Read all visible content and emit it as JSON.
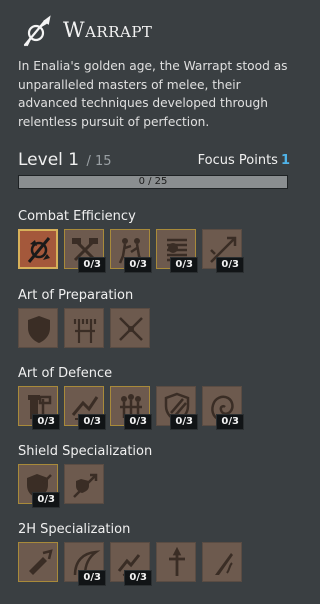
{
  "class": {
    "title": "Warrapt",
    "icon": "crossed-sword-emblem-icon",
    "description": "In Enalia's golden age, the Warrapt stood as unparalleled masters of melee, their advanced techniques developed through relentless pursuit of perfection."
  },
  "progress": {
    "level_label": "Level 1",
    "level_max": "/ 15",
    "focus_label": "Focus Points",
    "focus_value": "1",
    "xp_text": "0 / 25",
    "xp_fraction": 0
  },
  "sections": [
    {
      "title": "Combat Efficiency",
      "skills": [
        {
          "icon": "crossed-axe-emblem-icon",
          "rank": "",
          "state": "selected"
        },
        {
          "icon": "crossed-hammers-icon",
          "rank": "0/3",
          "state": "available"
        },
        {
          "icon": "fighting-warriors-icon",
          "rank": "0/3",
          "state": "available"
        },
        {
          "icon": "armored-figure-icon",
          "rank": "0/3",
          "state": "available"
        },
        {
          "icon": "spear-thrust-icon",
          "rank": "0/3",
          "state": "locked"
        }
      ]
    },
    {
      "title": "Art of Preparation",
      "skills": [
        {
          "icon": "shield-icon",
          "rank": "",
          "state": "locked"
        },
        {
          "icon": "trident-weapons-icon",
          "rank": "",
          "state": "locked"
        },
        {
          "icon": "crossed-weapons-icon",
          "rank": "",
          "state": "locked"
        }
      ]
    },
    {
      "title": "Art of Defence",
      "skills": [
        {
          "icon": "tower-hammer-icon",
          "rank": "0/3",
          "state": "available"
        },
        {
          "icon": "sword-slash-icon",
          "rank": "0/3",
          "state": "available"
        },
        {
          "icon": "group-defenders-icon",
          "rank": "0/3",
          "state": "available"
        },
        {
          "icon": "striped-shield-icon",
          "rank": "0/3",
          "state": "locked"
        },
        {
          "icon": "spiral-shell-icon",
          "rank": "0/3",
          "state": "locked"
        }
      ]
    },
    {
      "title": "Shield Specialization",
      "skills": [
        {
          "icon": "shield-bash-icon",
          "rank": "0/3",
          "state": "available"
        },
        {
          "icon": "shield-spear-icon",
          "rank": "",
          "state": "locked"
        }
      ]
    },
    {
      "title": "2H Specialization",
      "skills": [
        {
          "icon": "gauntlet-grip-icon",
          "rank": "",
          "state": "available"
        },
        {
          "icon": "curved-blade-icon",
          "rank": "0/3",
          "state": "locked"
        },
        {
          "icon": "heavy-strike-icon",
          "rank": "0/3",
          "state": "locked"
        },
        {
          "icon": "greatsword-cross-icon",
          "rank": "",
          "state": "locked"
        },
        {
          "icon": "fiery-blade-icon",
          "rank": "",
          "state": "locked"
        }
      ]
    }
  ]
}
